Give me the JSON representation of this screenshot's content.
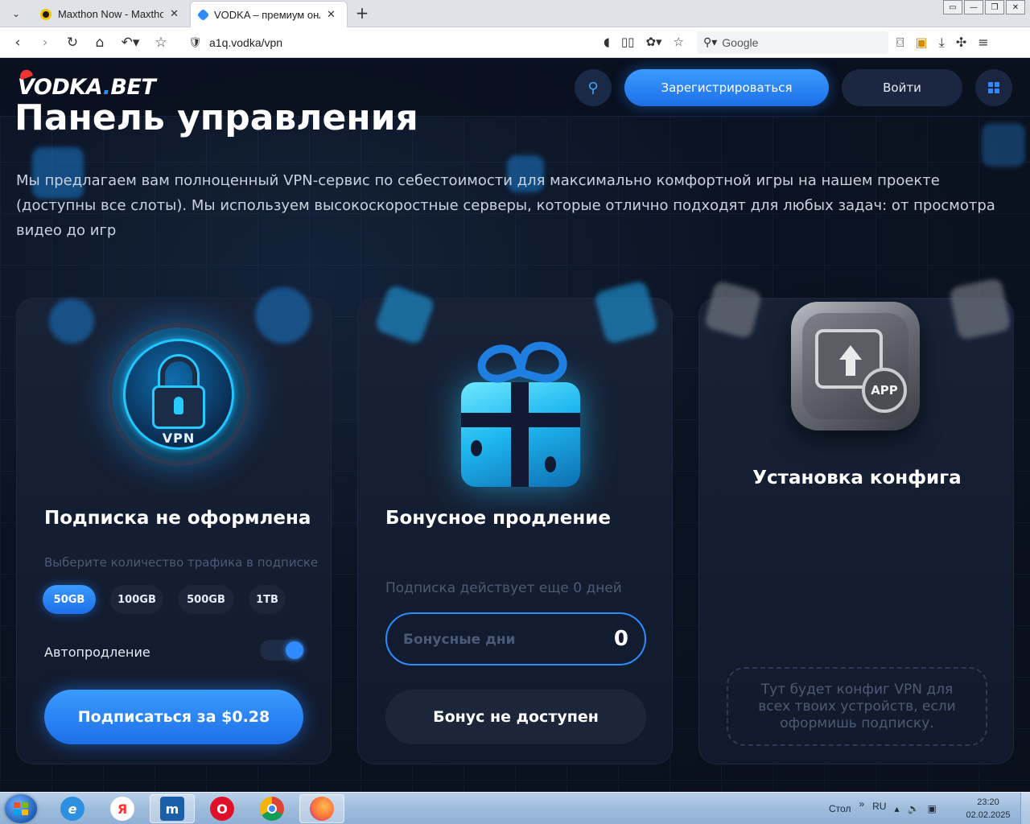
{
  "browser": {
    "tabs": [
      {
        "title": "Maxthon Now - Maxtho",
        "close": "✕"
      },
      {
        "title": "VODKA – премиум онла",
        "close": "✕"
      }
    ],
    "new_tab": "+",
    "url": "a1q.vodka/vpn",
    "search_placeholder": "Google",
    "window_controls": [
      "▭",
      "—",
      "❐",
      "✕"
    ]
  },
  "site": {
    "logo": {
      "main": "VODKA",
      "dot": ".",
      "suffix": "BET"
    },
    "register_label": "Зарегистрироваться",
    "login_label": "Войти",
    "title": "Панель управления",
    "description": "Мы предлагаем вам полноценный VPN-сервис по себестоимости для максимально комфортной игры на нашем проекте (доступны все слоты). Мы используем высокоскоростные серверы, которые отлично подходят для любых задач: от просмотра видео до игр"
  },
  "subscription_card": {
    "emblem_text": "VPN",
    "title": "Подписка не оформлена",
    "traffic_hint": "Выберите количество трафика в подписке",
    "traffic_options": [
      "50GB",
      "100GB",
      "500GB",
      "1TB"
    ],
    "selected_option": "50GB",
    "autorenew_label": "Автопродление",
    "autorenew_on": true,
    "subscribe_label": "Подписаться за $0.28"
  },
  "bonus_card": {
    "title": "Бонусное продление",
    "status": "Подписка действует еще 0 дней",
    "bonus_days_placeholder": "Бонусные дни",
    "bonus_days_value": "0",
    "button_label": "Бонус не доступен"
  },
  "config_card": {
    "badge_text": "APP",
    "title": "Установка конфига",
    "placeholder": "Тут будет конфиг VPN для всех твоих устройств, если оформишь подписку."
  },
  "taskbar": {
    "desktop_label": "Стол",
    "language": "RU",
    "time": "23:20",
    "date": "02.02.2025"
  },
  "colors": {
    "accent": "#2a8cff",
    "background": "#0b1120",
    "card": "#172237",
    "muted_text": "#4b5b77"
  }
}
